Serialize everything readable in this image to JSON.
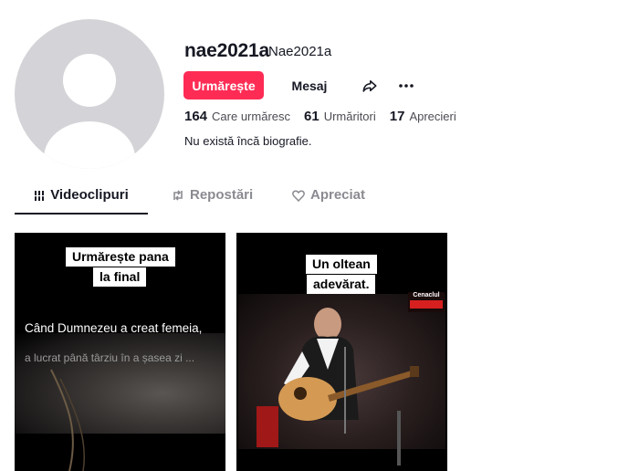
{
  "profile": {
    "username": "nae2021a",
    "nickname": "Nae2021a",
    "bio": "Nu există încă biografie."
  },
  "actions": {
    "follow_label": "Urmărește",
    "message_label": "Mesaj",
    "share_icon": "share-arrow-icon",
    "more_icon": "more-dots-icon"
  },
  "stats": {
    "following": {
      "value": "164",
      "label": "Care urmăresc"
    },
    "followers": {
      "value": "61",
      "label": "Urmăritori"
    },
    "likes": {
      "value": "17",
      "label": "Aprecieri"
    }
  },
  "tabs": [
    {
      "label": "Videoclipuri",
      "icon": "grid-lines-icon",
      "active": true
    },
    {
      "label": "Repostări",
      "icon": "repost-icon",
      "active": false
    },
    {
      "label": "Apreciat",
      "icon": "heart-outline-icon",
      "active": false
    }
  ],
  "videos": [
    {
      "caption_lines": [
        "Urmărește pana",
        "la final"
      ],
      "overlay_line1": "Când Dumnezeu a creat femeia,",
      "overlay_line2": "a lucrat până târziu în a șasea zi ..."
    },
    {
      "caption_lines": [
        "Un oltean",
        "adevărat."
      ],
      "logo_text": "Cenaclul"
    }
  ],
  "colors": {
    "accent": "#fe2c55",
    "text": "#161823",
    "muted": "#8a8b91"
  }
}
